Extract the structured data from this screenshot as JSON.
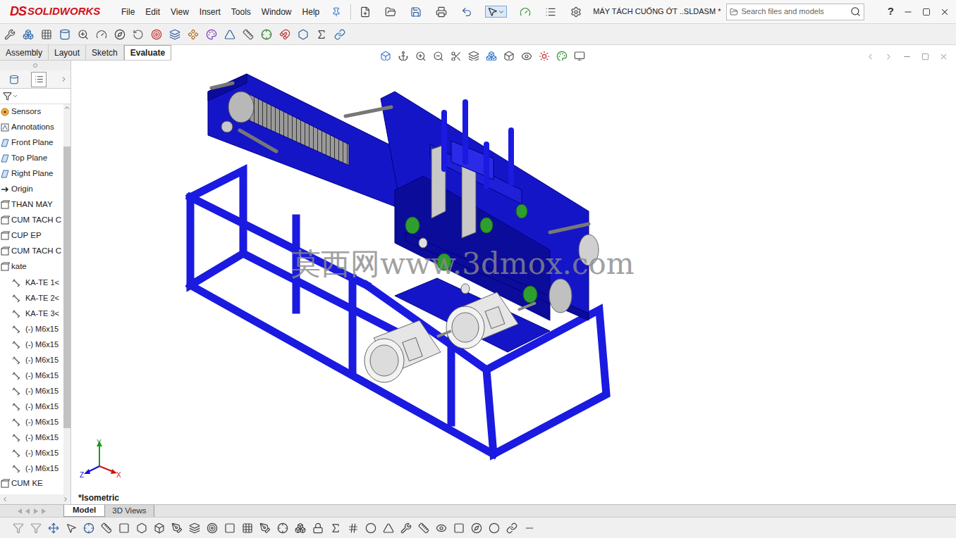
{
  "app": {
    "logo_mark": "DS",
    "logo_text": "SOLIDWORKS"
  },
  "menu": [
    "File",
    "Edit",
    "View",
    "Insert",
    "Tools",
    "Window",
    "Help"
  ],
  "document_title": "MÁY TÁCH CUỐNG ỚT ..SLDASM *",
  "search": {
    "placeholder": "Search files and models"
  },
  "help": "?",
  "command_tabs": [
    {
      "label": "Assembly",
      "selected": false
    },
    {
      "label": "Layout",
      "selected": false
    },
    {
      "label": "Sketch",
      "selected": false
    },
    {
      "label": "Evaluate",
      "selected": true
    }
  ],
  "feature_tree": {
    "items": [
      {
        "label": "Sensors",
        "kind": "sensors",
        "nested": false
      },
      {
        "label": "Annotations",
        "kind": "annotations",
        "nested": false
      },
      {
        "label": "Front Plane",
        "kind": "plane",
        "nested": false
      },
      {
        "label": "Top Plane",
        "kind": "plane",
        "nested": false
      },
      {
        "label": "Right Plane",
        "kind": "plane",
        "nested": false
      },
      {
        "label": "Origin",
        "kind": "origin",
        "nested": false
      },
      {
        "label": "THAN MAY",
        "kind": "subassembly",
        "nested": false
      },
      {
        "label": "CUM TACH C",
        "kind": "subassembly",
        "nested": false
      },
      {
        "label": "CUP EP",
        "kind": "subassembly",
        "nested": false
      },
      {
        "label": "CUM TACH C",
        "kind": "subassembly",
        "nested": false
      },
      {
        "label": "kate",
        "kind": "subassembly",
        "nested": false
      },
      {
        "label": "KA-TE 1<",
        "kind": "fastener",
        "nested": true
      },
      {
        "label": "KA-TE 2<",
        "kind": "fastener",
        "nested": true
      },
      {
        "label": "KA-TE 3<",
        "kind": "fastener",
        "nested": true
      },
      {
        "label": "(-) M6x15",
        "kind": "fastener",
        "nested": true
      },
      {
        "label": "(-) M6x15",
        "kind": "fastener",
        "nested": true
      },
      {
        "label": "(-) M6x15",
        "kind": "fastener",
        "nested": true
      },
      {
        "label": "(-) M6x15",
        "kind": "fastener",
        "nested": true
      },
      {
        "label": "(-) M6x15",
        "kind": "fastener",
        "nested": true
      },
      {
        "label": "(-) M6x15",
        "kind": "fastener",
        "nested": true
      },
      {
        "label": "(-) M6x15",
        "kind": "fastener",
        "nested": true
      },
      {
        "label": "(-) M6x15",
        "kind": "fastener",
        "nested": true
      },
      {
        "label": "(-) M6x15",
        "kind": "fastener",
        "nested": true
      },
      {
        "label": "(-) M6x15",
        "kind": "fastener",
        "nested": true
      },
      {
        "label": "CUM KE",
        "kind": "subassembly",
        "nested": false
      }
    ]
  },
  "viewport": {
    "view_label": "*Isometric",
    "watermark": "莫西网www.3dmox.com",
    "axes": {
      "x": "X",
      "y": "Y",
      "z": "Z"
    }
  },
  "bottom_tabs": [
    {
      "label": "Model",
      "selected": true
    },
    {
      "label": "3D Views",
      "selected": false
    }
  ]
}
